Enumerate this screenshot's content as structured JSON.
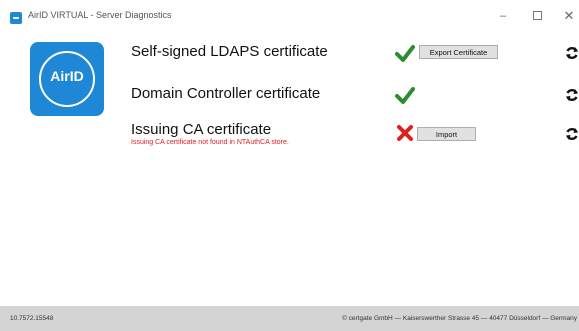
{
  "window": {
    "title": "AirID VIRTUAL - Server Diagnostics",
    "minimize_glyph": "–",
    "close_glyph": "✕"
  },
  "logo": {
    "text": "AirID"
  },
  "checks": [
    {
      "label": "Self-signed LDAPS certificate",
      "status": "ok",
      "button_label": "Export Certificate"
    },
    {
      "label": "Domain Controller certificate",
      "status": "ok"
    },
    {
      "label": "Issuing CA certificate",
      "status": "error",
      "error_message": "Issuing CA certificate not found in NTAuthCA store.",
      "button_label": "Import"
    }
  ],
  "footer": {
    "version": "10.7572.15548",
    "copyright": "© certgate GmbH — Kaiserswerther Strasse 45 — 40477 Düsseldorf — Germany"
  },
  "colors": {
    "brand": "#1e88d6",
    "ok": "#2e8b2e",
    "error": "#e02020",
    "footer_bg": "#d4d4d4"
  },
  "icons": {
    "ok": "check-icon",
    "error": "cross-icon",
    "refresh": "refresh-icon"
  }
}
